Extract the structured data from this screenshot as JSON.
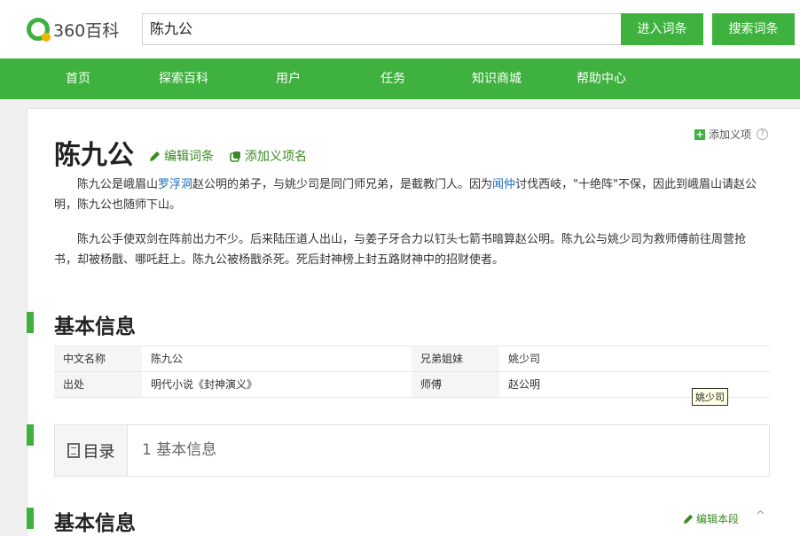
{
  "header": {
    "logo_text": "360百科",
    "search_value": "陈九公",
    "enter_button": "进入词条",
    "search_button": "搜索词条"
  },
  "nav": {
    "items": [
      "首页",
      "探索百科",
      "用户",
      "任务",
      "知识商城",
      "帮助中心"
    ]
  },
  "entry": {
    "title": "陈九公",
    "edit_label": "编辑词条",
    "add_sense_label": "添加义项名",
    "add_sense_right": "添加义项",
    "help_glyph": "?"
  },
  "paragraphs": {
    "p1_a": "陈九公是峨眉山",
    "p1_link1": "罗浮洞",
    "p1_b": "赵公明的弟子，与姚少司是同门师兄弟，是截教门人。因为",
    "p1_link2": "闻仲",
    "p1_c": "讨伐西岐，\"十绝阵\"不保，因此到峨眉山请赵公明，陈九公也随师下山。",
    "p2": "陈九公手使双剑在阵前出力不少。后来陆压道人出山，与姜子牙合力以钉头七箭书暗算赵公明。陈九公与姚少司为救师傅前往周营抢书，却被杨戬、哪吒赶上。陈九公被杨戬杀死。死后封神榜上封五路财神中的招财使者。"
  },
  "basic_info": {
    "title": "基本信息",
    "rows": [
      {
        "k1": "中文名称",
        "v1": "陈九公",
        "k2": "兄弟姐妹",
        "v2": "姚少司"
      },
      {
        "k1": "出处",
        "v1": "明代小说《封神演义》",
        "k2": "师傅",
        "v2": "赵公明"
      }
    ],
    "tooltip": "姚少司"
  },
  "catalog": {
    "label": "目录",
    "item": "1 基本信息"
  },
  "section2": {
    "title": "基本信息",
    "edit_label": "编辑本段",
    "collapse_glyph": "^"
  },
  "colors": {
    "brand_green": "#3eb13e",
    "link_blue": "#1a6bb8"
  }
}
